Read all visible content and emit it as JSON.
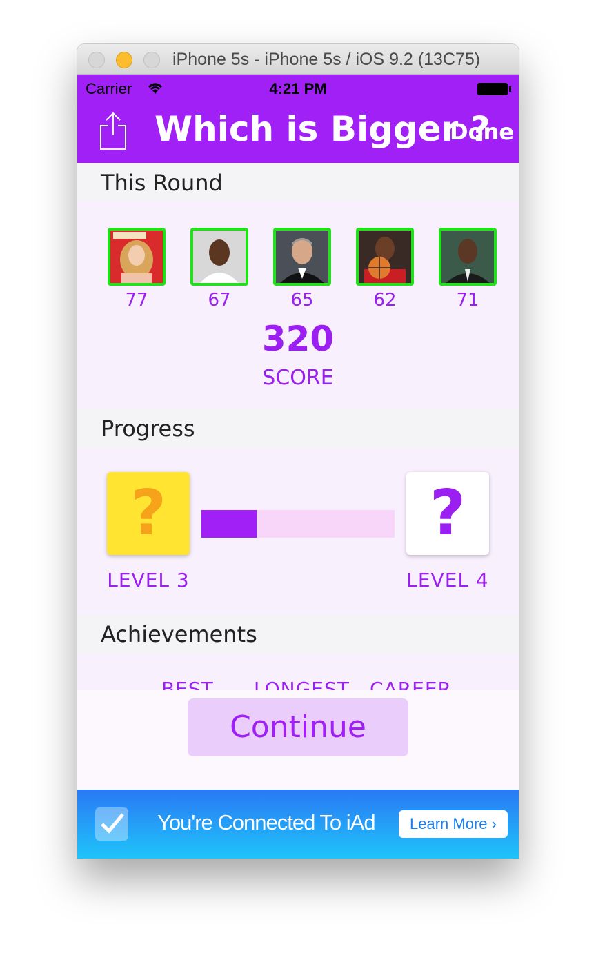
{
  "window": {
    "title": "iPhone 5s - iPhone 5s / iOS 9.2 (13C75)"
  },
  "status_bar": {
    "carrier": "Carrier",
    "time": "4:21 PM",
    "wifi_icon": "wifi-icon",
    "battery_icon": "battery-icon"
  },
  "nav": {
    "title": "Which is Bigger ?",
    "done_label": "Done",
    "share_icon": "share-icon"
  },
  "this_round": {
    "heading": "This Round",
    "items": [
      {
        "value": "77",
        "icon": "portrait-1"
      },
      {
        "value": "67",
        "icon": "portrait-2"
      },
      {
        "value": "65",
        "icon": "portrait-3"
      },
      {
        "value": "62",
        "icon": "portrait-4"
      },
      {
        "value": "71",
        "icon": "portrait-5"
      }
    ],
    "score": "320",
    "score_label": "SCORE"
  },
  "progress": {
    "heading": "Progress",
    "current_level": "LEVEL 3",
    "next_level": "LEVEL 4",
    "current_symbol": "?",
    "next_symbol": "?",
    "fraction": 0.285
  },
  "achievements": {
    "heading": "Achievements",
    "labels": [
      "BEST",
      "LONGEST",
      "CAREER"
    ]
  },
  "continue_label": "Continue",
  "ad": {
    "text": "You're Connected To iAd",
    "button": "Learn More ›"
  },
  "colors": {
    "accent": "#a020f5",
    "thumb_border": "#22e01a",
    "level_current": "#ffe531",
    "progress_fill": "#a020f5",
    "progress_track": "#f7d6fa"
  }
}
